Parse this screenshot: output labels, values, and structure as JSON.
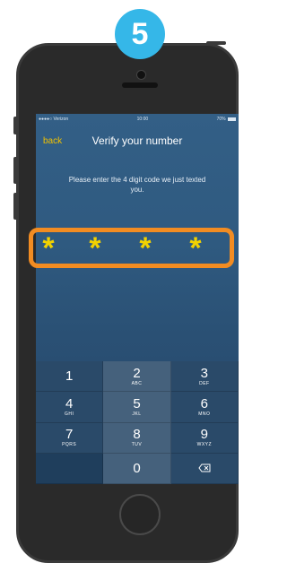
{
  "step": {
    "number": "5"
  },
  "status_bar": {
    "carrier": "●●●●○ Verizon",
    "time": "10:00",
    "battery": "70%"
  },
  "nav": {
    "back_label": "back",
    "title": "Verify your number"
  },
  "instruction": "Please enter the 4 digit code we just texted you.",
  "code": {
    "chars": [
      "*",
      "*",
      "*",
      "*"
    ]
  },
  "keypad": {
    "keys": [
      {
        "num": "1",
        "letters": ""
      },
      {
        "num": "2",
        "letters": "ABC"
      },
      {
        "num": "3",
        "letters": "DEF"
      },
      {
        "num": "4",
        "letters": "GHI"
      },
      {
        "num": "5",
        "letters": "JKL"
      },
      {
        "num": "6",
        "letters": "MNO"
      },
      {
        "num": "7",
        "letters": "PQRS"
      },
      {
        "num": "8",
        "letters": "TUV"
      },
      {
        "num": "9",
        "letters": "WXYZ"
      },
      {
        "num": "0",
        "letters": ""
      }
    ]
  },
  "colors": {
    "badge": "#35b7e8",
    "highlight": "#f28c22",
    "code_star": "#f2d200",
    "back_link": "#f2c200"
  },
  "icons": {
    "delete": "backspace-icon"
  }
}
